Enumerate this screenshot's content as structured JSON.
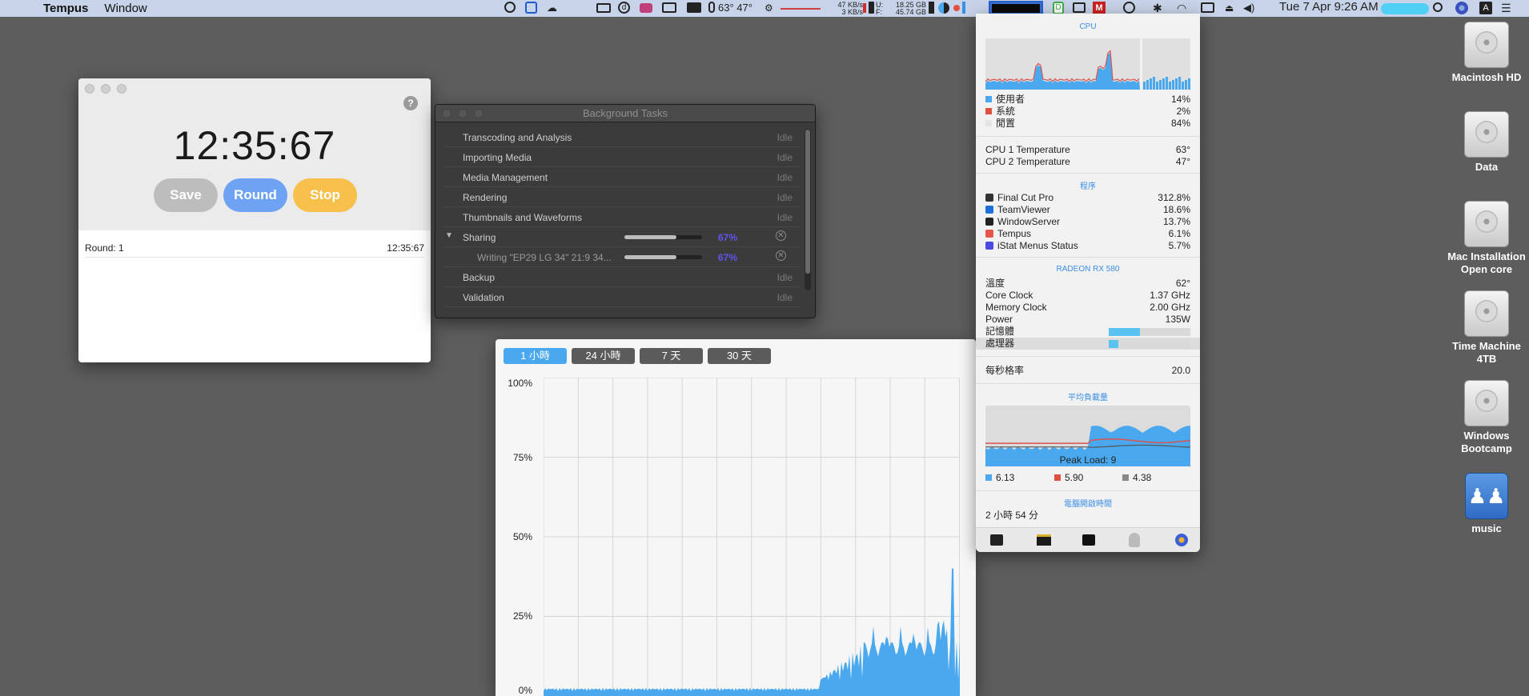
{
  "menubar": {
    "app_name": "Tempus",
    "menu_window": "Window",
    "temps": "63° 47°",
    "net_up": "47 KB/s",
    "net_down": "3 KB/s",
    "disk_u": "U:",
    "disk_f": "F:",
    "disk_used": "18.25 GB",
    "disk_free": "45.74 GB",
    "clock": "Tue 7 Apr  9:26 AM",
    "icons": [
      "apple-icon",
      "notification-icon",
      "teamviewer-icon",
      "cloud-icon",
      "layers-icon",
      "dashlane-icon",
      "tempus-icon",
      "airplay-icon",
      "display-icon",
      "temperature-icon",
      "fan-icon",
      "network-icon",
      "disk-icon",
      "battery-icon",
      "cpu-pie-icon",
      "istat-memory-icon",
      "dropbox-icon",
      "window-icon",
      "mail-icon",
      "time-machine-icon",
      "bluetooth-icon",
      "wifi-icon",
      "screen-mirror-icon",
      "eject-icon",
      "volume-icon",
      "search-icon",
      "siri-icon",
      "text-input-icon",
      "list-icon"
    ]
  },
  "desktop": {
    "icons": [
      {
        "label_lines": [
          "Macintosh HD"
        ],
        "kind": "hard-disk"
      },
      {
        "label_lines": [
          "Data"
        ],
        "kind": "hard-disk"
      },
      {
        "label_lines": [
          "Mac Installation",
          "Open core"
        ],
        "kind": "hard-disk"
      },
      {
        "label_lines": [
          "Time Machine",
          "4TB"
        ],
        "kind": "hard-disk"
      },
      {
        "label_lines": [
          "Windows",
          "Bootcamp"
        ],
        "kind": "hard-disk"
      },
      {
        "label_lines": [
          "music"
        ],
        "kind": "network-share"
      }
    ]
  },
  "tempus": {
    "time": "12:35:67",
    "help": "?",
    "buttons": {
      "save": "Save",
      "round": "Round",
      "stop": "Stop"
    },
    "colors": {
      "save": "#bdbdbd",
      "round": "#6ea3f4",
      "stop": "#f6c04a"
    },
    "rounds": [
      {
        "label": "Round: 1",
        "time": "12:35:67"
      }
    ]
  },
  "background_tasks": {
    "title": "Background Tasks",
    "rows": [
      {
        "name": "Transcoding and Analysis",
        "status": "Idle"
      },
      {
        "name": "Importing Media",
        "status": "Idle"
      },
      {
        "name": "Media Management",
        "status": "Idle"
      },
      {
        "name": "Rendering",
        "status": "Idle"
      },
      {
        "name": "Thumbnails and Waveforms",
        "status": "Idle"
      },
      {
        "name": "Sharing",
        "progress": 67,
        "percent": "67%",
        "expanded": true
      },
      {
        "name": "Writing \"EP29 LG 34\" 21:9 34...",
        "progress": 67,
        "percent": "67%",
        "child": true
      },
      {
        "name": "Backup",
        "status": "Idle"
      },
      {
        "name": "Validation",
        "status": "Idle"
      }
    ]
  },
  "history_graph": {
    "ranges": [
      "1 小時",
      "24 小時",
      "7 天",
      "30 天"
    ],
    "active_range": "1 小時",
    "y_labels": [
      "100%",
      "75%",
      "50%",
      "25%",
      "0%"
    ],
    "accent": "#4aa9ee"
  },
  "istat": {
    "cpu": {
      "header": "CPU",
      "rows": [
        {
          "label": "使用者",
          "value": "14%",
          "color": "#4aa9ee"
        },
        {
          "label": "系統",
          "value": "2%",
          "color": "#e05040"
        },
        {
          "label": "閒置",
          "value": "84%",
          "color": "#e4e4e4"
        }
      ],
      "temps": [
        {
          "label": "CPU 1 Temperature",
          "value": "63°"
        },
        {
          "label": "CPU 2 Temperature",
          "value": "47°"
        }
      ]
    },
    "processes": {
      "header": "程序",
      "rows": [
        {
          "label": "Final Cut Pro",
          "value": "312.8%",
          "icon": "final-cut-pro-icon",
          "color": "#333333"
        },
        {
          "label": "TeamViewer",
          "value": "18.6%",
          "icon": "teamviewer-icon",
          "color": "#1e6fd9"
        },
        {
          "label": "WindowServer",
          "value": "13.7%",
          "icon": "windowserver-icon",
          "color": "#222222"
        },
        {
          "label": "Tempus",
          "value": "6.1%",
          "icon": "tempus-icon",
          "color": "#e8554a"
        },
        {
          "label": "iStat Menus Status",
          "value": "5.7%",
          "icon": "istat-icon",
          "color": "#4a4ae0"
        }
      ]
    },
    "gpu": {
      "header": "RADEON RX 580",
      "rows": [
        {
          "label": "溫度",
          "value": "62°"
        },
        {
          "label": "Core Clock",
          "value": "1.37 GHz"
        },
        {
          "label": "Memory Clock",
          "value": "2.00 GHz"
        },
        {
          "label": "Power",
          "value": "135W"
        }
      ],
      "bars": [
        {
          "label": "記憶體",
          "fraction": 0.38
        },
        {
          "label": "處理器",
          "fraction": 0.12
        }
      ]
    },
    "fps": {
      "label": "每秒格率",
      "value": "20.0"
    },
    "load": {
      "header": "平均負載量",
      "peak": "Peak Load: 9",
      "values": [
        {
          "value": "6.13",
          "color": "#4aa9ee"
        },
        {
          "value": "5.90",
          "color": "#e05040"
        },
        {
          "value": "4.38",
          "color": "#888888"
        }
      ]
    },
    "uptime": {
      "header": "電腦開啟時間",
      "value": "2 小時 54 分"
    },
    "footer_icons": [
      "activity-monitor-icon",
      "gpu-icon",
      "terminal-icon",
      "disk-utility-icon",
      "istat-icon"
    ]
  }
}
